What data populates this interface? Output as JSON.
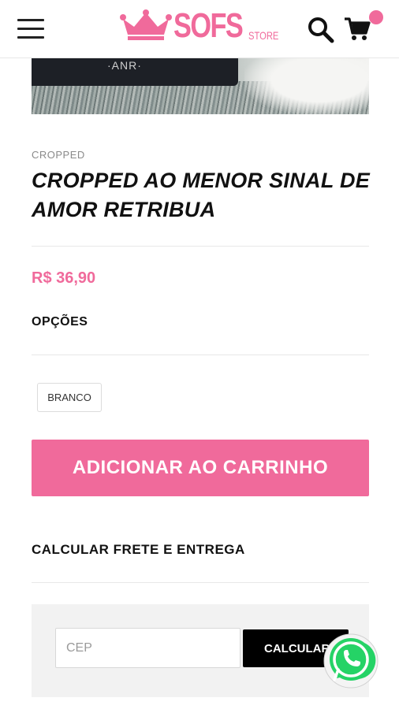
{
  "header": {
    "brand": "SOFS",
    "brand_sub": "STORE",
    "menu_icon": "hamburger-menu-icon",
    "search_icon": "search-icon",
    "cart_icon": "shopping-cart-icon",
    "accent_color": "#f06a9b"
  },
  "product": {
    "image_print_text": "·ANR·",
    "category": "CROPPED",
    "title": "CROPPED AO MENOR SINAL DE AMOR RETRIBUA",
    "price": "R$ 36,90",
    "options_label": "OPÇÕES",
    "options": [
      "BRANCO"
    ],
    "add_to_cart_label": "ADICIONAR AO CARRINHO"
  },
  "shipping": {
    "label": "CALCULAR FRETE E ENTREGA",
    "cep_placeholder": "CEP",
    "calculate_label": "CALCULAR"
  },
  "floating": {
    "whatsapp_icon": "whatsapp-icon",
    "whatsapp_color": "#25d366"
  }
}
